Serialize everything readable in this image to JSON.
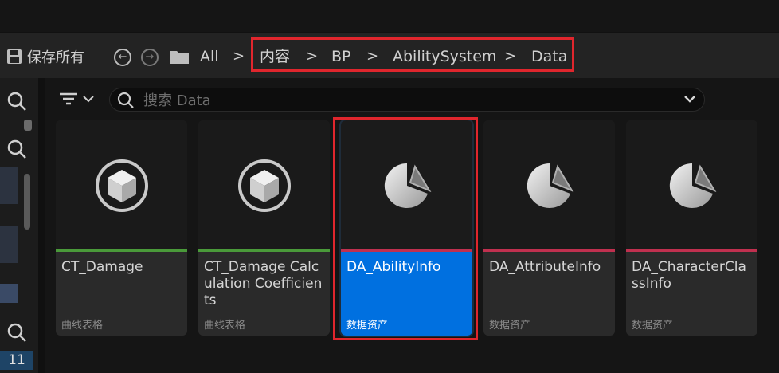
{
  "toolbar": {
    "save_label": "保存所有",
    "breadcrumb": [
      "All",
      "内容",
      "BP",
      "AbilitySystem",
      "Data"
    ],
    "separator": ">"
  },
  "search": {
    "placeholder": "搜索 Data"
  },
  "left_panel": {
    "count_badge": "11"
  },
  "assets": [
    {
      "name": "CT_Damage",
      "type": "曲线表格",
      "icon": "curve-table-icon",
      "color": "#4a9a3a"
    },
    {
      "name": "CT_Damage Calculation Coefficients",
      "type": "曲线表格",
      "icon": "curve-table-icon",
      "color": "#4a9a3a"
    },
    {
      "name": "DA_AbilityInfo",
      "type": "数据资产",
      "icon": "data-asset-icon",
      "color": "#c0304f",
      "selected": true
    },
    {
      "name": "DA_AttributeInfo",
      "type": "数据资产",
      "icon": "data-asset-icon",
      "color": "#c0304f"
    },
    {
      "name": "DA_CharacterClassInfo",
      "type": "数据资产",
      "icon": "data-asset-icon",
      "color": "#c0304f"
    }
  ],
  "colors": {
    "accent": "#0070e0",
    "highlight": "#e0262d",
    "curve_table": "#4a9a3a",
    "data_asset": "#c0304f"
  }
}
